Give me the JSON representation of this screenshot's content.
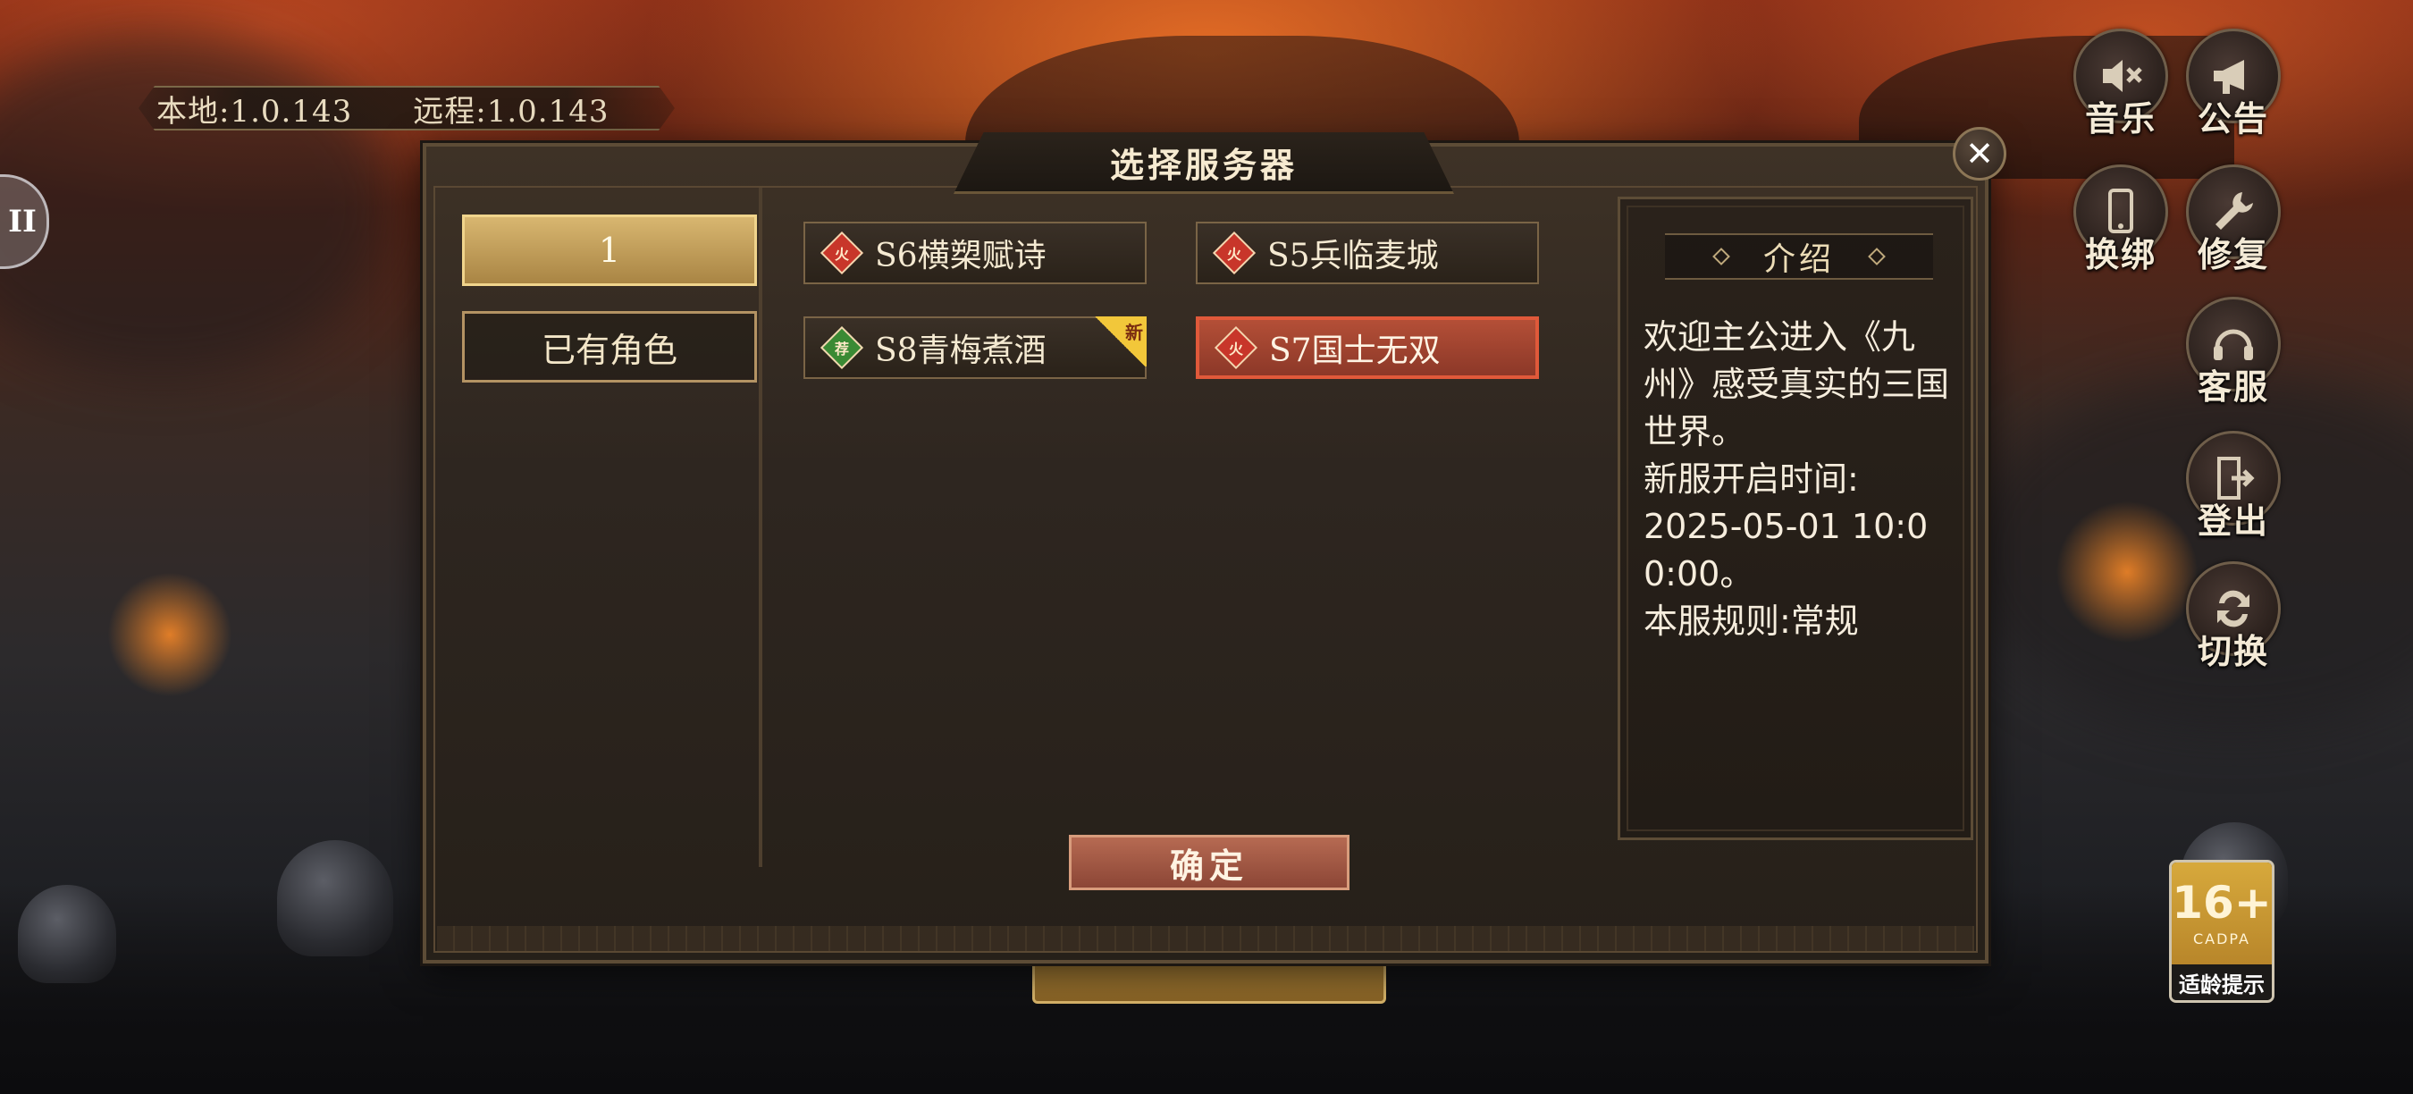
{
  "version": {
    "local": "本地:1.0.143",
    "remote": "远程:1.0.143"
  },
  "side_toggle": {
    "label": "II"
  },
  "right_menu": [
    {
      "label": "音乐",
      "icon": "mute-speaker-icon"
    },
    {
      "label": "公告",
      "icon": "megaphone-icon"
    },
    {
      "label": "换绑",
      "icon": "phone-icon"
    },
    {
      "label": "修复",
      "icon": "wrench-icon"
    },
    {
      "label": "客服",
      "icon": "headset-icon"
    },
    {
      "label": "登出",
      "icon": "logout-door-icon"
    },
    {
      "label": "切换",
      "icon": "switch-arrows-icon"
    }
  ],
  "age_rating": {
    "age": "16+",
    "org": "CADPA",
    "tip": "适龄提示"
  },
  "dialog": {
    "title": "选择服务器",
    "close": "✕",
    "tabs": [
      {
        "label": "1",
        "selected": true
      },
      {
        "label": "已有角色",
        "selected": false
      }
    ],
    "servers": [
      {
        "name": "S6横槊赋诗",
        "badge": "火",
        "badge_type": "fire",
        "active": false,
        "is_new": false
      },
      {
        "name": "S5兵临麦城",
        "badge": "火",
        "badge_type": "fire",
        "active": false,
        "is_new": false
      },
      {
        "name": "S8青梅煮酒",
        "badge": "荐",
        "badge_type": "recommend",
        "active": false,
        "is_new": true,
        "new_label": "新"
      },
      {
        "name": "S7国士无双",
        "badge": "火",
        "badge_type": "fire",
        "active": true,
        "is_new": false
      }
    ],
    "info": {
      "heading": "介绍",
      "text": "欢迎主公进入《九州》感受真实的三国世界。\n新服开启时间:\n2025-05-01 10:00:00。\n本服规则:常规"
    },
    "confirm": "确定"
  },
  "colors": {
    "gold_tab": "#d8b670",
    "active_server_border": "#e0593a",
    "fire_badge": "#c8362a",
    "recommend_badge": "#3a8a34",
    "new_tag": "#f2c73a",
    "confirm_button": "#b66a52"
  }
}
